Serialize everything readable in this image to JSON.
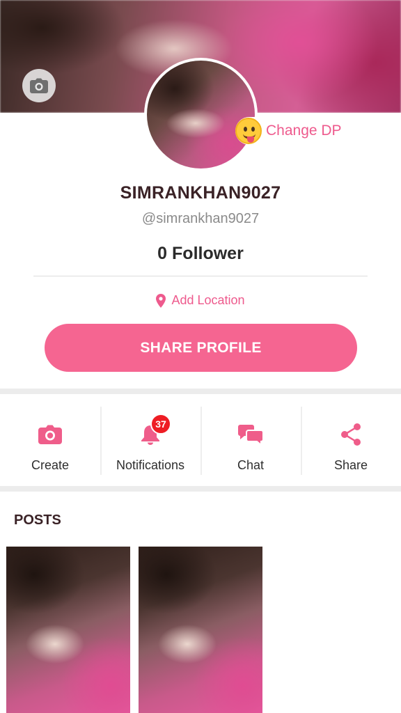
{
  "profile": {
    "change_dp_label": "Change DP",
    "username": "SIMRANKHAN9027",
    "handle": "@simrankhan9027",
    "followers": "0 Follower",
    "location_label": "Add Location",
    "share_button": "SHARE PROFILE"
  },
  "actions": [
    {
      "label": "Create",
      "icon": "camera-icon"
    },
    {
      "label": "Notifications",
      "icon": "bell-icon",
      "badge": "37"
    },
    {
      "label": "Chat",
      "icon": "chat-icon"
    },
    {
      "label": "Share",
      "icon": "share-icon"
    }
  ],
  "posts": {
    "title": "POSTS",
    "count": 2
  },
  "colors": {
    "accent": "#f56591",
    "accent_text": "#ee5a8d",
    "badge": "#ee1d24",
    "heading": "#3a2226"
  }
}
